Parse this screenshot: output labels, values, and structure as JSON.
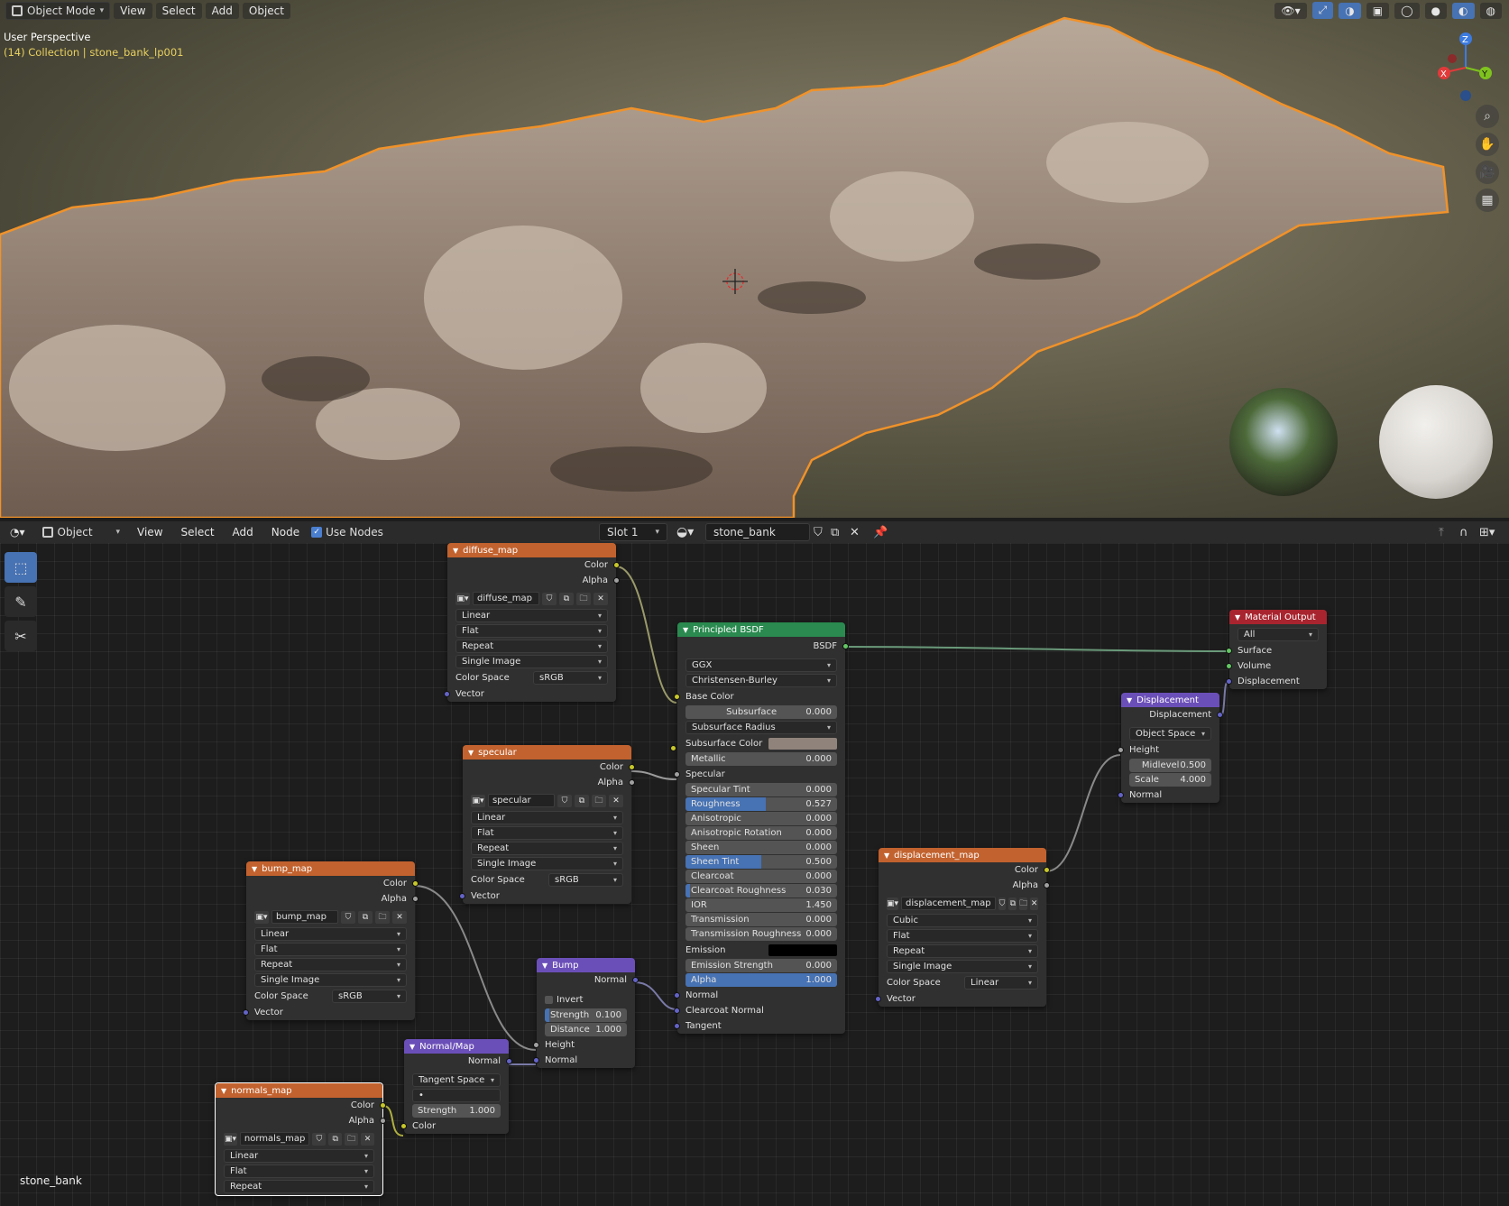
{
  "viewport": {
    "mode": "Object Mode",
    "menu": [
      "View",
      "Select",
      "Add",
      "Object"
    ],
    "info_title": "User Perspective",
    "info_collection": "(14) Collection | stone_bank_lp001",
    "axes": {
      "x": "X",
      "y": "Y",
      "z": "Z"
    }
  },
  "node_header": {
    "mode": "Object",
    "menu": [
      "View",
      "Select",
      "Add",
      "Node"
    ],
    "use_nodes": "Use Nodes",
    "slot": "Slot 1",
    "material": "stone_bank"
  },
  "status": {
    "object_name": "stone_bank"
  },
  "nodes": {
    "diffuse": {
      "title": "diffuse_map",
      "color": "Color",
      "alpha": "Alpha",
      "image": "diffuse_map",
      "interp": "Linear",
      "proj": "Flat",
      "ext": "Repeat",
      "source": "Single Image",
      "cs_label": "Color Space",
      "cs": "sRGB",
      "vector": "Vector"
    },
    "specular": {
      "title": "specular",
      "color": "Color",
      "alpha": "Alpha",
      "image": "specular",
      "interp": "Linear",
      "proj": "Flat",
      "ext": "Repeat",
      "source": "Single Image",
      "cs_label": "Color Space",
      "cs": "sRGB",
      "vector": "Vector"
    },
    "bump_map": {
      "title": "bump_map",
      "color": "Color",
      "alpha": "Alpha",
      "image": "bump_map",
      "interp": "Linear",
      "proj": "Flat",
      "ext": "Repeat",
      "source": "Single Image",
      "cs_label": "Color Space",
      "cs": "sRGB",
      "vector": "Vector"
    },
    "normals": {
      "title": "normals_map",
      "color": "Color",
      "alpha": "Alpha",
      "image": "normals_map",
      "interp": "Linear",
      "proj": "Flat",
      "ext": "Repeat"
    },
    "displacement_map": {
      "title": "displacement_map",
      "color": "Color",
      "alpha": "Alpha",
      "image": "displacement_map",
      "interp": "Cubic",
      "proj": "Flat",
      "ext": "Repeat",
      "source": "Single Image",
      "cs_label": "Color Space",
      "cs": "Linear",
      "vector": "Vector"
    },
    "bump": {
      "title": "Bump",
      "normal_out": "Normal",
      "invert": "Invert",
      "strength_label": "Strength",
      "strength": "0.100",
      "distance_label": "Distance",
      "distance": "1.000",
      "height": "Height",
      "normal_in": "Normal"
    },
    "normalmap": {
      "title": "Normal/Map",
      "normal_out": "Normal",
      "space": "Tangent Space",
      "uv": "•",
      "strength_label": "Strength",
      "strength": "1.000",
      "color": "Color"
    },
    "bsdf": {
      "title": "Principled BSDF",
      "out": "BSDF",
      "dist": "GGX",
      "sss": "Christensen-Burley",
      "base_color": "Base Color",
      "subsurface_label": "Subsurface",
      "subsurface": "0.000",
      "sss_radius": "Subsurface Radius",
      "sss_color": "Subsurface Color",
      "metallic_label": "Metallic",
      "metallic": "0.000",
      "specular": "Specular",
      "spec_tint_label": "Specular Tint",
      "spec_tint": "0.000",
      "roughness_label": "Roughness",
      "roughness": "0.527",
      "roughness_frac": 0.527,
      "aniso_label": "Anisotropic",
      "aniso": "0.000",
      "aniso_rot_label": "Anisotropic Rotation",
      "aniso_rot": "0.000",
      "sheen_label": "Sheen",
      "sheen": "0.000",
      "sheen_tint_label": "Sheen Tint",
      "sheen_tint": "0.500",
      "sheen_tint_frac": 0.5,
      "clearcoat_label": "Clearcoat",
      "clearcoat": "0.000",
      "cc_rough_label": "Clearcoat Roughness",
      "cc_rough": "0.030",
      "ior_label": "IOR",
      "ior": "1.450",
      "trans_label": "Transmission",
      "trans": "0.000",
      "trans_rough_label": "Transmission Roughness",
      "trans_rough": "0.000",
      "emission": "Emission",
      "em_strength_label": "Emission Strength",
      "em_strength": "0.000",
      "alpha_label": "Alpha",
      "alpha": "1.000",
      "alpha_frac": 1.0,
      "normal": "Normal",
      "cc_normal": "Clearcoat Normal",
      "tangent": "Tangent",
      "sss_color_hex": "#8f837b",
      "emission_hex": "#000000"
    },
    "disp": {
      "title": "Displacement",
      "out": "Displacement",
      "space": "Object Space",
      "height": "Height",
      "midlevel_label": "Midlevel",
      "midlevel": "0.500",
      "scale_label": "Scale",
      "scale": "4.000",
      "normal": "Normal"
    },
    "output": {
      "title": "Material Output",
      "target": "All",
      "surface": "Surface",
      "volume": "Volume",
      "displacement": "Displacement"
    }
  },
  "colors": {
    "accent": "#4772b3",
    "texture_header": "#c2622e",
    "shader_header": "#2a8a4f",
    "vector_header": "#6b4fb8",
    "output_header": "#a8242e",
    "selection_outline": "#f0922a"
  }
}
